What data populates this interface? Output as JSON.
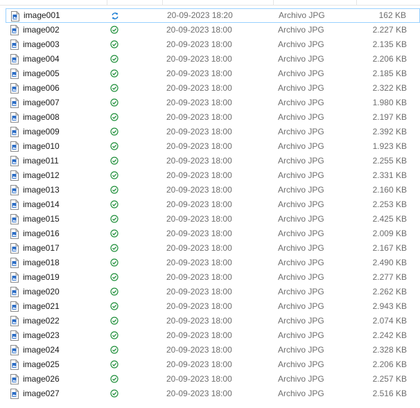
{
  "colors": {
    "sync_blue": "#1e7fd4",
    "ok_green": "#1f8f3a",
    "selection_border": "#99d1ff",
    "file_icon_blue": "#2b6cc4"
  },
  "icons": {
    "file": "jpg-file-icon",
    "status_syncing": "sync-icon",
    "status_ok": "check-circle-icon"
  },
  "files": [
    {
      "name": "image001",
      "status": "syncing",
      "date": "20-09-2023 18:20",
      "type": "Archivo JPG",
      "size": "162 KB"
    },
    {
      "name": "image002",
      "status": "ok",
      "date": "20-09-2023 18:00",
      "type": "Archivo JPG",
      "size": "2.227 KB"
    },
    {
      "name": "image003",
      "status": "ok",
      "date": "20-09-2023 18:00",
      "type": "Archivo JPG",
      "size": "2.135 KB"
    },
    {
      "name": "image004",
      "status": "ok",
      "date": "20-09-2023 18:00",
      "type": "Archivo JPG",
      "size": "2.206 KB"
    },
    {
      "name": "image005",
      "status": "ok",
      "date": "20-09-2023 18:00",
      "type": "Archivo JPG",
      "size": "2.185 KB"
    },
    {
      "name": "image006",
      "status": "ok",
      "date": "20-09-2023 18:00",
      "type": "Archivo JPG",
      "size": "2.322 KB"
    },
    {
      "name": "image007",
      "status": "ok",
      "date": "20-09-2023 18:00",
      "type": "Archivo JPG",
      "size": "1.980 KB"
    },
    {
      "name": "image008",
      "status": "ok",
      "date": "20-09-2023 18:00",
      "type": "Archivo JPG",
      "size": "2.197 KB"
    },
    {
      "name": "image009",
      "status": "ok",
      "date": "20-09-2023 18:00",
      "type": "Archivo JPG",
      "size": "2.392 KB"
    },
    {
      "name": "image010",
      "status": "ok",
      "date": "20-09-2023 18:00",
      "type": "Archivo JPG",
      "size": "1.923 KB"
    },
    {
      "name": "image011",
      "status": "ok",
      "date": "20-09-2023 18:00",
      "type": "Archivo JPG",
      "size": "2.255 KB"
    },
    {
      "name": "image012",
      "status": "ok",
      "date": "20-09-2023 18:00",
      "type": "Archivo JPG",
      "size": "2.331 KB"
    },
    {
      "name": "image013",
      "status": "ok",
      "date": "20-09-2023 18:00",
      "type": "Archivo JPG",
      "size": "2.160 KB"
    },
    {
      "name": "image014",
      "status": "ok",
      "date": "20-09-2023 18:00",
      "type": "Archivo JPG",
      "size": "2.253 KB"
    },
    {
      "name": "image015",
      "status": "ok",
      "date": "20-09-2023 18:00",
      "type": "Archivo JPG",
      "size": "2.425 KB"
    },
    {
      "name": "image016",
      "status": "ok",
      "date": "20-09-2023 18:00",
      "type": "Archivo JPG",
      "size": "2.009 KB"
    },
    {
      "name": "image017",
      "status": "ok",
      "date": "20-09-2023 18:00",
      "type": "Archivo JPG",
      "size": "2.167 KB"
    },
    {
      "name": "image018",
      "status": "ok",
      "date": "20-09-2023 18:00",
      "type": "Archivo JPG",
      "size": "2.490 KB"
    },
    {
      "name": "image019",
      "status": "ok",
      "date": "20-09-2023 18:00",
      "type": "Archivo JPG",
      "size": "2.277 KB"
    },
    {
      "name": "image020",
      "status": "ok",
      "date": "20-09-2023 18:00",
      "type": "Archivo JPG",
      "size": "2.262 KB"
    },
    {
      "name": "image021",
      "status": "ok",
      "date": "20-09-2023 18:00",
      "type": "Archivo JPG",
      "size": "2.943 KB"
    },
    {
      "name": "image022",
      "status": "ok",
      "date": "20-09-2023 18:00",
      "type": "Archivo JPG",
      "size": "2.074 KB"
    },
    {
      "name": "image023",
      "status": "ok",
      "date": "20-09-2023 18:00",
      "type": "Archivo JPG",
      "size": "2.242 KB"
    },
    {
      "name": "image024",
      "status": "ok",
      "date": "20-09-2023 18:00",
      "type": "Archivo JPG",
      "size": "2.328 KB"
    },
    {
      "name": "image025",
      "status": "ok",
      "date": "20-09-2023 18:00",
      "type": "Archivo JPG",
      "size": "2.206 KB"
    },
    {
      "name": "image026",
      "status": "ok",
      "date": "20-09-2023 18:00",
      "type": "Archivo JPG",
      "size": "2.257 KB"
    },
    {
      "name": "image027",
      "status": "ok",
      "date": "20-09-2023 18:00",
      "type": "Archivo JPG",
      "size": "2.516 KB"
    }
  ]
}
